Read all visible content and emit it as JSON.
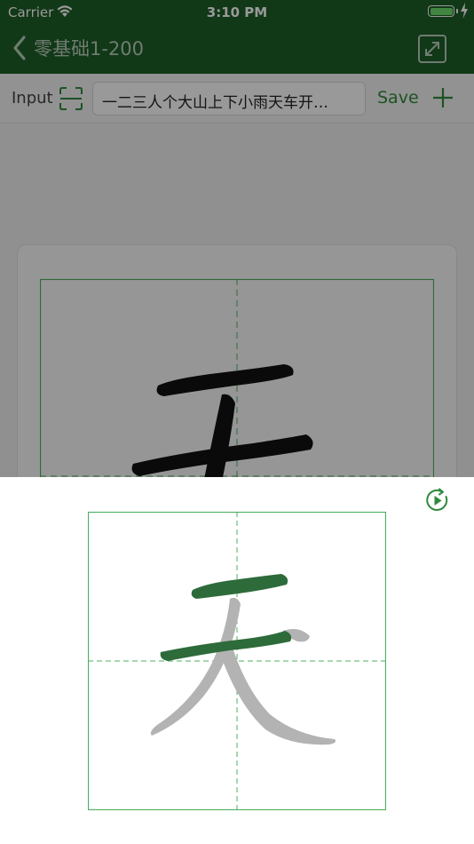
{
  "status_bar": {
    "carrier": "Carrier",
    "time": "3:10 PM",
    "battery_level": 1.0
  },
  "nav": {
    "title": "零基础1-200"
  },
  "input_bar": {
    "label": "Input",
    "value": "一二三人个大山上下小雨天车开…",
    "save_label": "Save"
  },
  "character": "天",
  "colors": {
    "nav_background": "#1d5e27",
    "accent": "#2e8b3c",
    "grid_line": "#4caf60",
    "stroke_done": "#2e6b3b",
    "stroke_pending": "#b3b3b3"
  },
  "icons": {
    "back": "chevron-left-icon",
    "expand": "expand-icon",
    "scan": "scan-icon",
    "add": "plus-icon",
    "replay": "play-circle-icon"
  }
}
